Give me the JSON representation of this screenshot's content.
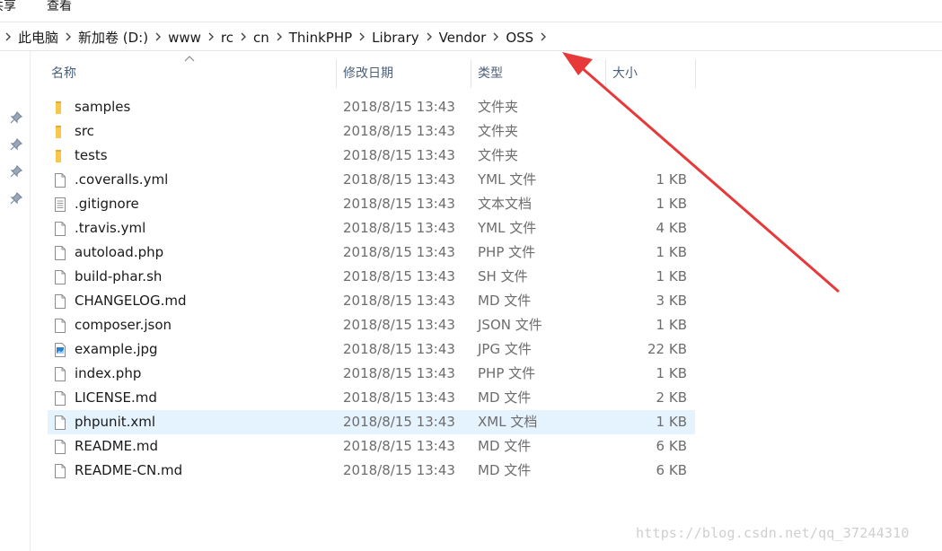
{
  "menu": {
    "share_label": "共享",
    "view_label": "查看"
  },
  "breadcrumb": [
    "此电脑",
    "新加卷 (D:)",
    "www",
    "rc",
    "cn",
    "ThinkPHP",
    "Library",
    "Vendor",
    "OSS"
  ],
  "columns": {
    "name": "名称",
    "date": "修改日期",
    "type": "类型",
    "size": "大小"
  },
  "files": [
    {
      "name": "samples",
      "date": "2018/8/15 13:43",
      "type": "文件夹",
      "size": "",
      "icon": "folder-icon"
    },
    {
      "name": "src",
      "date": "2018/8/15 13:43",
      "type": "文件夹",
      "size": "",
      "icon": "folder-icon"
    },
    {
      "name": "tests",
      "date": "2018/8/15 13:43",
      "type": "文件夹",
      "size": "",
      "icon": "folder-icon"
    },
    {
      "name": ".coveralls.yml",
      "date": "2018/8/15 13:43",
      "type": "YML 文件",
      "size": "1 KB",
      "icon": "file-icon"
    },
    {
      "name": ".gitignore",
      "date": "2018/8/15 13:43",
      "type": "文本文档",
      "size": "1 KB",
      "icon": "text-file-icon"
    },
    {
      "name": ".travis.yml",
      "date": "2018/8/15 13:43",
      "type": "YML 文件",
      "size": "4 KB",
      "icon": "file-icon"
    },
    {
      "name": "autoload.php",
      "date": "2018/8/15 13:43",
      "type": "PHP 文件",
      "size": "1 KB",
      "icon": "file-icon"
    },
    {
      "name": "build-phar.sh",
      "date": "2018/8/15 13:43",
      "type": "SH 文件",
      "size": "1 KB",
      "icon": "file-icon"
    },
    {
      "name": "CHANGELOG.md",
      "date": "2018/8/15 13:43",
      "type": "MD 文件",
      "size": "3 KB",
      "icon": "file-icon"
    },
    {
      "name": "composer.json",
      "date": "2018/8/15 13:43",
      "type": "JSON 文件",
      "size": "1 KB",
      "icon": "file-icon"
    },
    {
      "name": "example.jpg",
      "date": "2018/8/15 13:43",
      "type": "JPG 文件",
      "size": "22 KB",
      "icon": "image-file-icon"
    },
    {
      "name": "index.php",
      "date": "2018/8/15 13:43",
      "type": "PHP 文件",
      "size": "1 KB",
      "icon": "file-icon"
    },
    {
      "name": "LICENSE.md",
      "date": "2018/8/15 13:43",
      "type": "MD 文件",
      "size": "2 KB",
      "icon": "file-icon"
    },
    {
      "name": "phpunit.xml",
      "date": "2018/8/15 13:43",
      "type": "XML 文档",
      "size": "1 KB",
      "icon": "file-icon",
      "selected": true
    },
    {
      "name": "README.md",
      "date": "2018/8/15 13:43",
      "type": "MD 文件",
      "size": "6 KB",
      "icon": "file-icon"
    },
    {
      "name": "README-CN.md",
      "date": "2018/8/15 13:43",
      "type": "MD 文件",
      "size": "6 KB",
      "icon": "file-icon"
    }
  ],
  "watermark": "https://blog.csdn.net/qq_37244310",
  "colors": {
    "annotation_arrow": "#e8393a",
    "selection": "#e5f3ff",
    "folder": "#f7c84b"
  }
}
